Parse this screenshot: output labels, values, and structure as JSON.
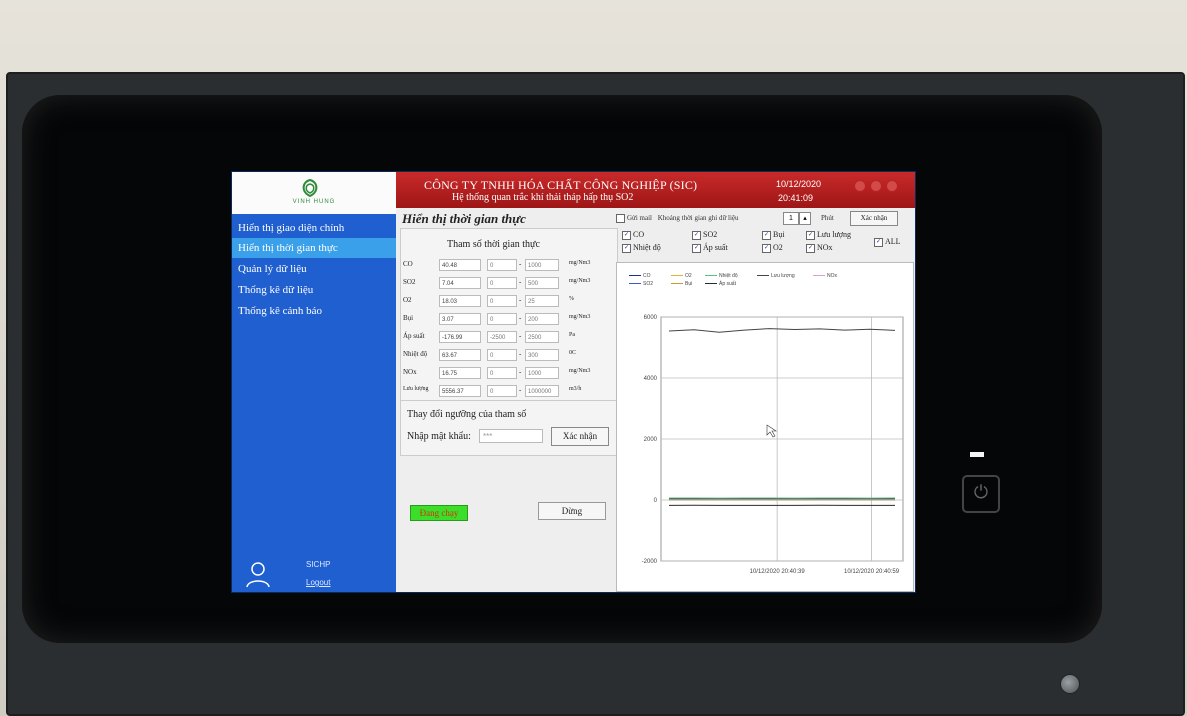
{
  "sidebar": {
    "logo_text": "VINH HUNG",
    "items": [
      {
        "label": "Hiển thị giao diện chính"
      },
      {
        "label": "Hiển thị thời gian thực"
      },
      {
        "label": "Quản lý dữ liệu"
      },
      {
        "label": "Thống kê dữ liệu"
      },
      {
        "label": "Thống kê cảnh báo"
      }
    ],
    "active_index": 1,
    "user_name": "SICHP",
    "logout_label": "Logout"
  },
  "header": {
    "company": "CÔNG TY TNHH HÓA CHẤT CÔNG NGHIỆP (SIC)",
    "system": "Hệ thống quan trắc khí thải tháp hấp thụ SO2",
    "date": "10/12/2020",
    "time": "20:41:09",
    "colors": {
      "header": "#b51f1f",
      "sidebar": "#1f5fcf",
      "active": "#3aa0ea"
    }
  },
  "page": {
    "title": "Hiển thị thời gian thực",
    "save_label": "Gửi mail",
    "interval_label": "Khoảng thời gian ghi dữ liệu",
    "interval_value": "1",
    "interval_unit": "Phút",
    "confirm_label": "Xác nhận"
  },
  "params": {
    "title": "Tham số thời gian thực",
    "rows": [
      {
        "name": "CO",
        "value": "40.48",
        "min": "0",
        "max": "1000",
        "unit": "mg/Nm3"
      },
      {
        "name": "SO2",
        "value": "7.04",
        "min": "0",
        "max": "500",
        "unit": "mg/Nm3"
      },
      {
        "name": "O2",
        "value": "18.03",
        "min": "0",
        "max": "25",
        "unit": "%"
      },
      {
        "name": "Bụi",
        "value": "3.07",
        "min": "0",
        "max": "200",
        "unit": "mg/Nm3"
      },
      {
        "name": "Áp suất",
        "value": "-176.99",
        "min": "-2500",
        "max": "2500",
        "unit": "Pa"
      },
      {
        "name": "Nhiệt độ",
        "value": "63.67",
        "min": "0",
        "max": "300",
        "unit": "0C"
      },
      {
        "name": "NOx",
        "value": "16.75",
        "min": "0",
        "max": "1000",
        "unit": "mg/Nm3"
      },
      {
        "name": "Lưu lượng",
        "value": "5556.37",
        "min": "0",
        "max": "1000000",
        "unit": "m3/h"
      }
    ]
  },
  "threshold": {
    "title": "Thay đổi ngưỡng của tham số",
    "password_label": "Nhập mật khẩu:",
    "password_value": "***",
    "confirm_label": "Xác nhận"
  },
  "controls": {
    "run_label": "Đang chạy",
    "stop_label": "Dừng"
  },
  "checks": [
    {
      "label": "CO",
      "checked": true
    },
    {
      "label": "SO2",
      "checked": true
    },
    {
      "label": "Bụi",
      "checked": true
    },
    {
      "label": "Lưu lượng",
      "checked": true
    },
    {
      "label": "Nhiệt độ",
      "checked": true
    },
    {
      "label": "Áp suất",
      "checked": true
    },
    {
      "label": "O2",
      "checked": true
    },
    {
      "label": "NOx",
      "checked": true
    },
    {
      "label": "ALL",
      "checked": true
    }
  ],
  "chart_data": {
    "type": "line",
    "title": "",
    "xlabel": "",
    "ylabel": "",
    "ylim": [
      -2000,
      6000
    ],
    "y_ticks": [
      "6000",
      "4000",
      "2000",
      "0",
      "-2000"
    ],
    "x_ticks": [
      "10/12/2020 20:40:39",
      "10/12/2020 20:40:59"
    ],
    "grid": true,
    "legend_position": "top",
    "series": [
      {
        "name": "CO",
        "color": "#1f2f8f",
        "values": [
          40,
          41,
          40,
          42,
          40,
          41,
          40,
          41,
          40,
          40
        ]
      },
      {
        "name": "O2",
        "color": "#e0b23a",
        "values": [
          18,
          18,
          18,
          18,
          18,
          18,
          18,
          18,
          18,
          18
        ]
      },
      {
        "name": "Nhiệt độ",
        "color": "#55c37a",
        "values": [
          64,
          64,
          63,
          64,
          64,
          63,
          64,
          64,
          63,
          64
        ]
      },
      {
        "name": "Lưu lượng",
        "color": "#444444",
        "values": [
          5540,
          5580,
          5500,
          5570,
          5620,
          5590,
          5610,
          5570,
          5600,
          5560
        ]
      },
      {
        "name": "NOx",
        "color": "#d9a2d0",
        "values": [
          17,
          16,
          17,
          17,
          16,
          17,
          17,
          16,
          17,
          17
        ]
      },
      {
        "name": "SO2",
        "color": "#3a58c8",
        "values": [
          7,
          7,
          7,
          7,
          7,
          7,
          7,
          7,
          7,
          7
        ]
      },
      {
        "name": "Bụi",
        "color": "#c79a3c",
        "values": [
          3,
          3,
          3,
          3,
          3,
          3,
          3,
          3,
          3,
          3
        ]
      },
      {
        "name": "Áp suất",
        "color": "#2a2a2a",
        "values": [
          -177,
          -175,
          -178,
          -176,
          -177,
          -176,
          -175,
          -177,
          -176,
          -177
        ]
      }
    ]
  }
}
